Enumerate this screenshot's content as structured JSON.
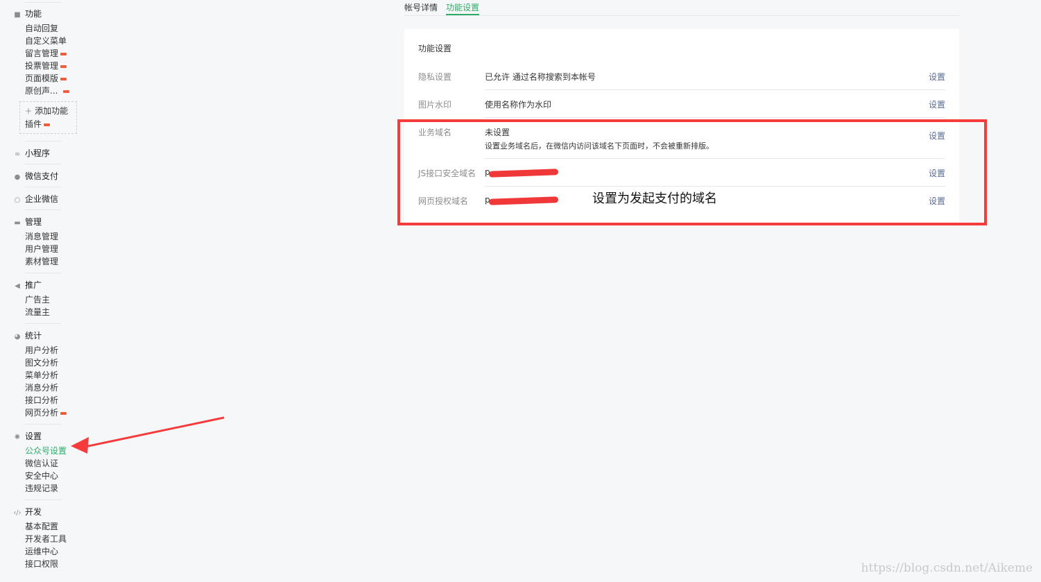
{
  "sidebar": {
    "sections": [
      {
        "title": "功能",
        "icon": "grid-icon",
        "items": [
          {
            "label": "自动回复"
          },
          {
            "label": "自定义菜单"
          },
          {
            "label": "留言管理",
            "new": true
          },
          {
            "label": "投票管理",
            "new": true
          },
          {
            "label": "页面模版",
            "new": true
          },
          {
            "label": "原创声...",
            "new": true
          }
        ]
      },
      {
        "title": "小程序",
        "icon": "link-icon",
        "items": []
      },
      {
        "title": "微信支付",
        "icon": "pay-icon",
        "items": []
      },
      {
        "title": "企业微信",
        "icon": "search-icon",
        "items": []
      },
      {
        "title": "管理",
        "icon": "inbox-icon",
        "items": [
          {
            "label": "消息管理"
          },
          {
            "label": "用户管理"
          },
          {
            "label": "素材管理"
          }
        ]
      },
      {
        "title": "推广",
        "icon": "megaphone-icon",
        "items": [
          {
            "label": "广告主"
          },
          {
            "label": "流量主"
          }
        ]
      },
      {
        "title": "统计",
        "icon": "pie-chart-icon",
        "items": [
          {
            "label": "用户分析"
          },
          {
            "label": "图文分析"
          },
          {
            "label": "菜单分析"
          },
          {
            "label": "消息分析"
          },
          {
            "label": "接口分析"
          },
          {
            "label": "网页分析",
            "new": true
          }
        ]
      },
      {
        "title": "设置",
        "icon": "gear-icon",
        "items": [
          {
            "label": "公众号设置",
            "active": true
          },
          {
            "label": "微信认证"
          },
          {
            "label": "安全中心"
          },
          {
            "label": "违规记录"
          }
        ]
      },
      {
        "title": "开发",
        "icon": "code-icon",
        "items": [
          {
            "label": "基本配置"
          },
          {
            "label": "开发者工具"
          },
          {
            "label": "运维中心"
          },
          {
            "label": "接口权限"
          }
        ]
      }
    ],
    "add_function": {
      "plus": "+",
      "label": "添加功能",
      "plugin_label": "插件"
    }
  },
  "tabs": [
    {
      "label": "帐号详情",
      "active": false
    },
    {
      "label": "功能设置",
      "active": true
    }
  ],
  "panel": {
    "title": "功能设置",
    "rows": [
      {
        "label": "隐私设置",
        "value": "已允许 通过名称搜索到本帐号",
        "action": "设置"
      },
      {
        "label": "图片水印",
        "value": "使用名称作为水印",
        "action": "设置"
      },
      {
        "label": "业务域名",
        "value": "未设置",
        "sub": "设置业务域名后，在微信内访问该域名下页面时，不会被重新排版。",
        "action": "设置"
      },
      {
        "label": "JS接口安全域名",
        "value": "p",
        "redacted": true,
        "action": "设置"
      },
      {
        "label": "网页授权域名",
        "value": "p",
        "redacted": true,
        "action": "设置"
      }
    ]
  },
  "annotation": {
    "text": "设置为发起支付的域名",
    "color": "#f53b3b"
  },
  "watermark": "https://blog.csdn.net/Aikeme",
  "colors": {
    "accent": "#2aae67",
    "link": "#576b95",
    "annotation": "#f53b3b",
    "new_badge": "#f25c38"
  }
}
